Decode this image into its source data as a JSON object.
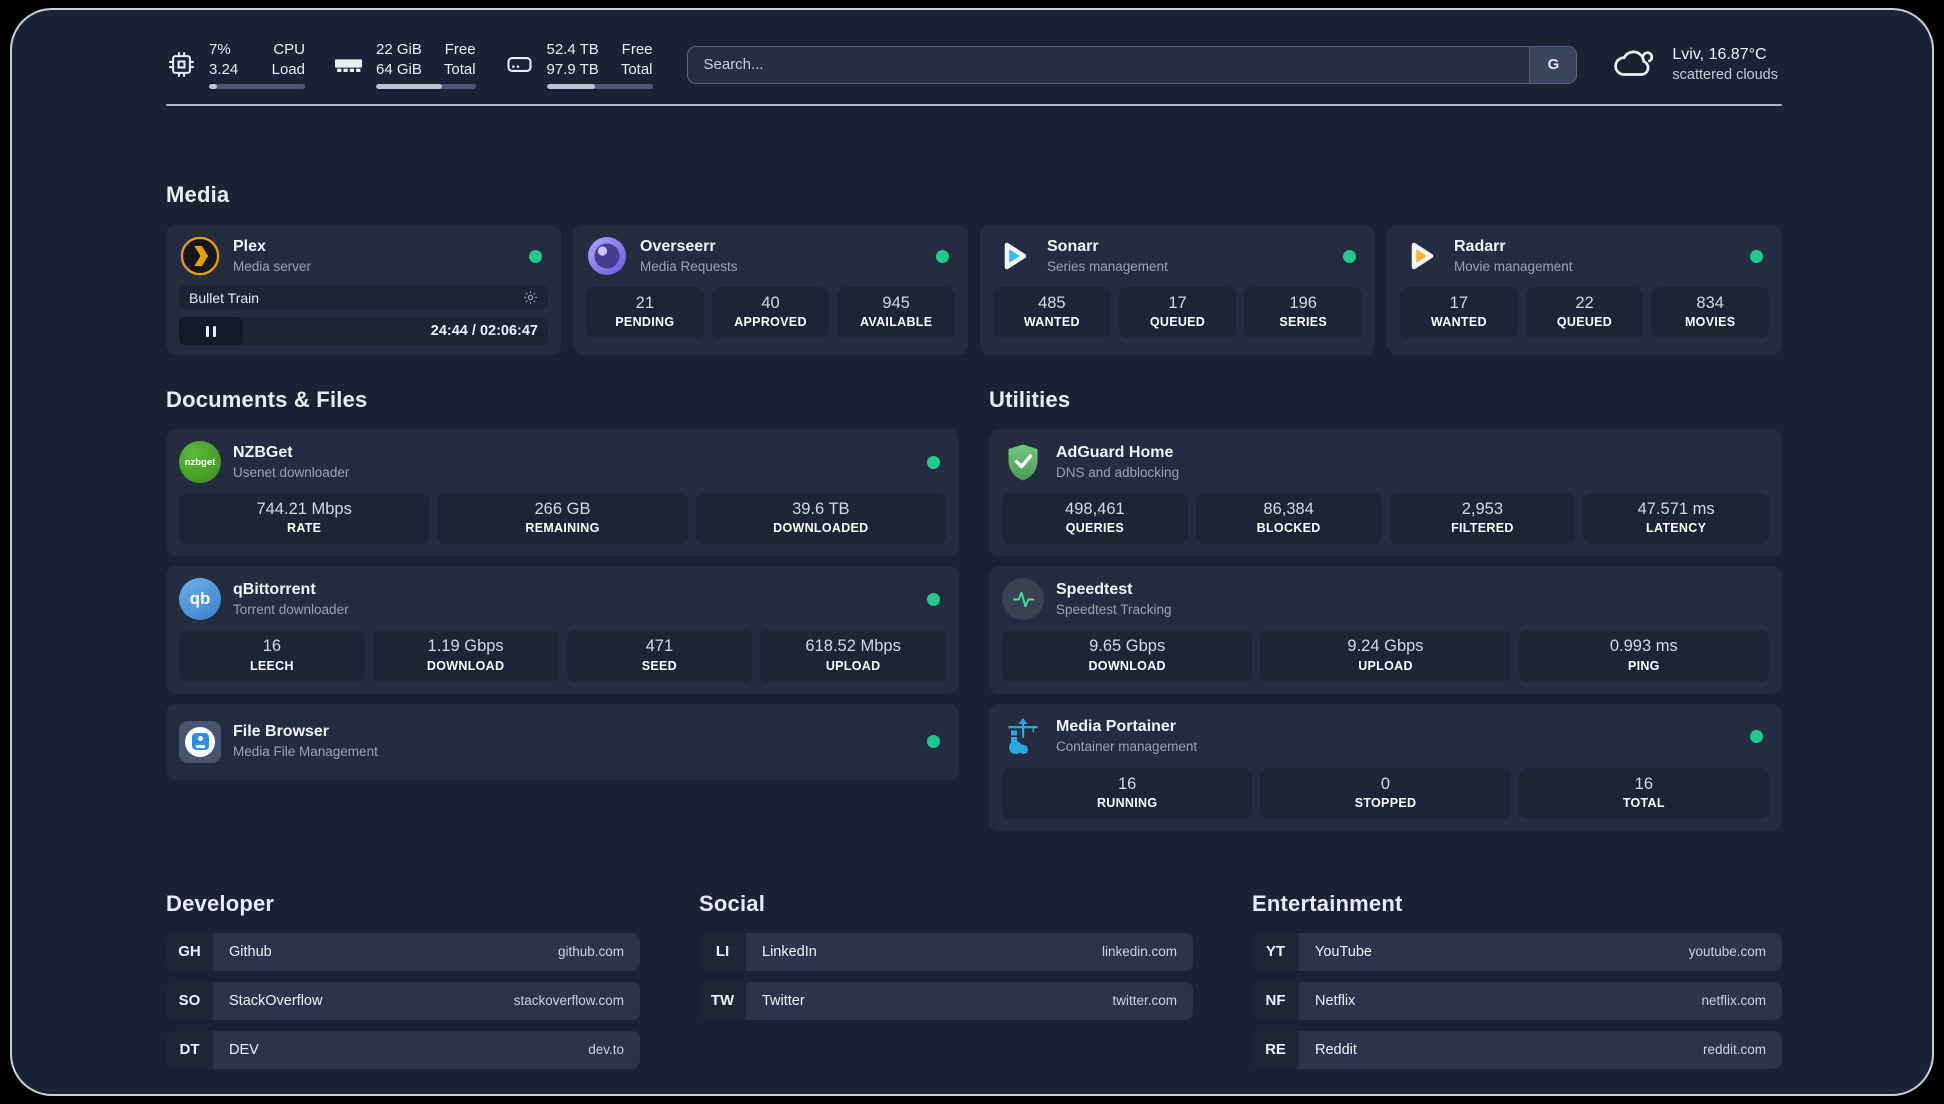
{
  "colors": {
    "status_online": "#23c98c",
    "plex_accent": "#e5a00d",
    "background": "#1b2234"
  },
  "header": {
    "metrics": [
      {
        "icon": "cpu",
        "value1": "7%",
        "value2": "3.24",
        "label1": "CPU",
        "label2": "Load",
        "progress": 8
      },
      {
        "icon": "memory",
        "value1": "22 GiB",
        "value2": "64 GiB",
        "label1": "Free",
        "label2": "Total",
        "progress": 66
      },
      {
        "icon": "disk",
        "value1": "52.4 TB",
        "value2": "97.9 TB",
        "label1": "Free",
        "label2": "Total",
        "progress": 46
      }
    ],
    "search": {
      "placeholder": "Search...",
      "provider_button": "G"
    },
    "weather": {
      "location": "Lviv, 16.87°C",
      "condition": "scattered clouds"
    }
  },
  "media": {
    "title": "Media",
    "plex": {
      "name": "Plex",
      "desc": "Media server",
      "now_playing": "Bullet Train",
      "time": "24:44 / 02:06:47"
    },
    "overseerr": {
      "name": "Overseerr",
      "desc": "Media Requests",
      "stats": [
        {
          "value": "21",
          "label": "PENDING"
        },
        {
          "value": "40",
          "label": "APPROVED"
        },
        {
          "value": "945",
          "label": "AVAILABLE"
        }
      ]
    },
    "sonarr": {
      "name": "Sonarr",
      "desc": "Series management",
      "stats": [
        {
          "value": "485",
          "label": "WANTED"
        },
        {
          "value": "17",
          "label": "QUEUED"
        },
        {
          "value": "196",
          "label": "SERIES"
        }
      ]
    },
    "radarr": {
      "name": "Radarr",
      "desc": "Movie management",
      "stats": [
        {
          "value": "17",
          "label": "WANTED"
        },
        {
          "value": "22",
          "label": "QUEUED"
        },
        {
          "value": "834",
          "label": "MOVIES"
        }
      ]
    }
  },
  "documents": {
    "title": "Documents & Files",
    "nzbget": {
      "name": "NZBGet",
      "desc": "Usenet downloader",
      "stats": [
        {
          "value": "744.21 Mbps",
          "label": "RATE"
        },
        {
          "value": "266 GB",
          "label": "REMAINING"
        },
        {
          "value": "39.6 TB",
          "label": "DOWNLOADED"
        }
      ]
    },
    "qbittorrent": {
      "name": "qBittorrent",
      "desc": "Torrent downloader",
      "stats": [
        {
          "value": "16",
          "label": "LEECH"
        },
        {
          "value": "1.19 Gbps",
          "label": "DOWNLOAD"
        },
        {
          "value": "471",
          "label": "SEED"
        },
        {
          "value": "618.52 Mbps",
          "label": "UPLOAD"
        }
      ]
    },
    "filebrowser": {
      "name": "File Browser",
      "desc": "Media File Management"
    }
  },
  "utilities": {
    "title": "Utilities",
    "adguard": {
      "name": "AdGuard Home",
      "desc": "DNS and adblocking",
      "stats": [
        {
          "value": "498,461",
          "label": "QUERIES"
        },
        {
          "value": "86,384",
          "label": "BLOCKED"
        },
        {
          "value": "2,953",
          "label": "FILTERED"
        },
        {
          "value": "47.571 ms",
          "label": "LATENCY"
        }
      ]
    },
    "speedtest": {
      "name": "Speedtest",
      "desc": "Speedtest Tracking",
      "stats": [
        {
          "value": "9.65 Gbps",
          "label": "DOWNLOAD"
        },
        {
          "value": "9.24 Gbps",
          "label": "UPLOAD"
        },
        {
          "value": "0.993 ms",
          "label": "PING"
        }
      ]
    },
    "portainer": {
      "name": "Media Portainer",
      "desc": "Container management",
      "stats": [
        {
          "value": "16",
          "label": "RUNNING"
        },
        {
          "value": "0",
          "label": "STOPPED"
        },
        {
          "value": "16",
          "label": "TOTAL"
        }
      ]
    }
  },
  "links": {
    "developer": {
      "title": "Developer",
      "items": [
        {
          "abbr": "GH",
          "name": "Github",
          "url": "github.com"
        },
        {
          "abbr": "SO",
          "name": "StackOverflow",
          "url": "stackoverflow.com"
        },
        {
          "abbr": "DT",
          "name": "DEV",
          "url": "dev.to"
        }
      ]
    },
    "social": {
      "title": "Social",
      "items": [
        {
          "abbr": "LI",
          "name": "LinkedIn",
          "url": "linkedin.com"
        },
        {
          "abbr": "TW",
          "name": "Twitter",
          "url": "twitter.com"
        }
      ]
    },
    "entertainment": {
      "title": "Entertainment",
      "items": [
        {
          "abbr": "YT",
          "name": "YouTube",
          "url": "youtube.com"
        },
        {
          "abbr": "NF",
          "name": "Netflix",
          "url": "netflix.com"
        },
        {
          "abbr": "RE",
          "name": "Reddit",
          "url": "reddit.com"
        }
      ]
    }
  }
}
